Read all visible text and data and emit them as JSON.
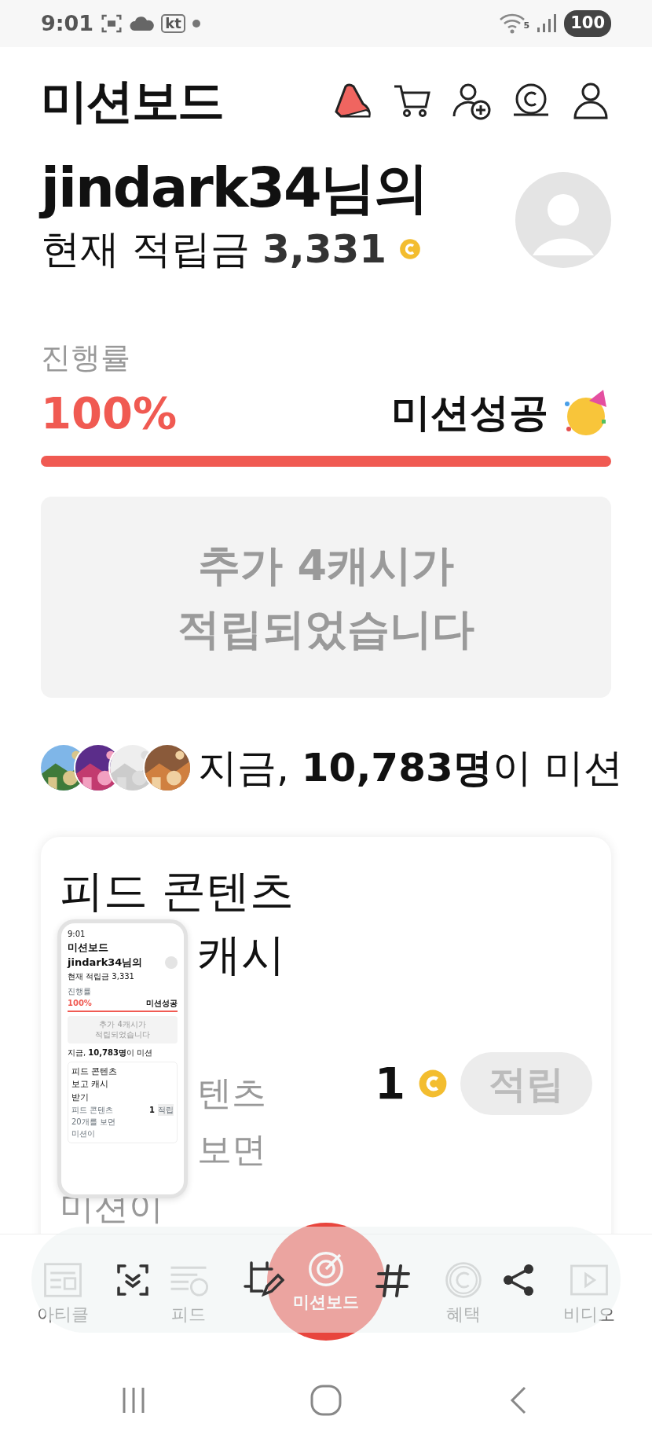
{
  "status_bar": {
    "time": "9:01",
    "carrier": "kt",
    "network": "5",
    "battery": "100"
  },
  "header": {
    "title": "미션보드"
  },
  "profile": {
    "greeting": "jindark34님의",
    "balance_label": "현재 적립금",
    "balance": "3,331"
  },
  "progress": {
    "label": "진행률",
    "percent": "100%",
    "level": 1,
    "status": "미션성공"
  },
  "notice": {
    "lines": [
      "추가 4캐시가",
      "적립되었습니다"
    ]
  },
  "live": {
    "text": "지금, **10,783명**이 미션"
  },
  "mission_card": {
    "title": "피드 콘텐츠",
    "title_rest": "캐시",
    "description": [
      "텐츠",
      "보면",
      "미션이"
    ],
    "reward": "1",
    "button": "적립",
    "disabled": true
  },
  "screenshot_preview": {
    "time": "9:01",
    "title": "미션보드",
    "greeting": "jindark34님의",
    "balance": "현재 적립금 3,331",
    "progress_label": "진행률",
    "percent": "100%",
    "status": "미션성공",
    "notice": [
      "추가 4캐시가",
      "적립되었습니다"
    ],
    "live": "지금, **10,783명**이 미션",
    "card_title": [
      "피드 콘텐츠",
      "보고 캐시",
      "받기"
    ],
    "description": [
      "피드 콘텐츠",
      "20개를 보면",
      "미션이"
    ],
    "reward": "1",
    "button": "적립"
  },
  "bottom_nav": {
    "items": [
      {
        "label": "아티클",
        "kind": "article",
        "selected": false
      },
      {
        "label": "피드",
        "kind": "feed",
        "selected": false
      },
      {
        "label": "미션보드",
        "kind": "mission",
        "selected": true
      },
      {
        "label": "혜택",
        "kind": "benefit",
        "selected": false
      },
      {
        "label": "비디오",
        "kind": "video",
        "selected": false
      }
    ]
  }
}
